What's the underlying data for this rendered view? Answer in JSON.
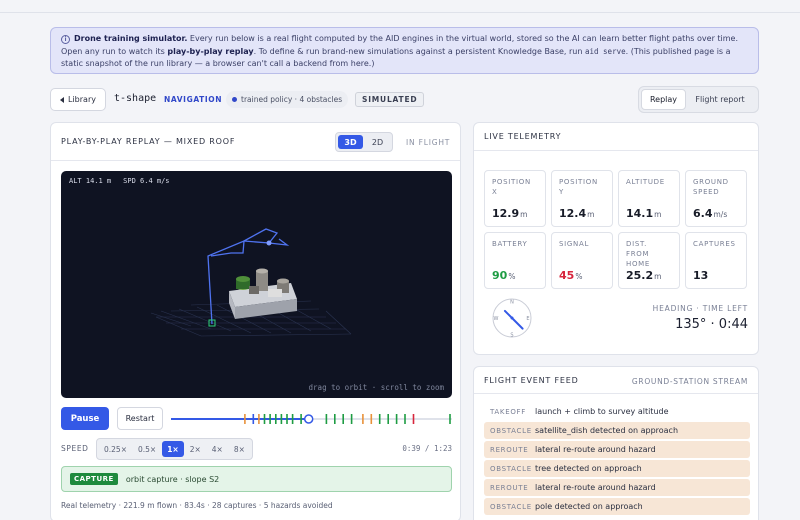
{
  "banner": {
    "title": "Drone training simulator.",
    "text1": " Every run below is a real flight computed by the AID engines in the virtual world, stored so the AI can learn better flight paths over time. Open any run to watch its ",
    "bold2": "play-by-play replay",
    "text2": ". To define & run brand-new simulations against a persistent Knowledge Base, run ",
    "code": "aid serve",
    "text3": ". (This published page is a static snapshot of the run library — a browser can't call a backend from here.)"
  },
  "toolbar": {
    "library_label": "Library",
    "run_name": "t-shape",
    "category": "NAVIGATION",
    "policy": "trained policy · 4 obstacles",
    "badge": "SIMULATED",
    "views": [
      "Replay",
      "Flight report"
    ]
  },
  "replay": {
    "title": "PLAY-BY-PLAY REPLAY — MIXED ROOF",
    "modes": [
      "3D",
      "2D"
    ],
    "status": "IN FLIGHT",
    "hud_alt": "ALT 14.1 m",
    "hud_spd": "SPD 6.4 m/s",
    "hint": "drag to orbit · scroll to zoom",
    "pause_label": "Pause",
    "restart_label": "Restart",
    "progress": 0.49,
    "speed_label": "SPEED",
    "speeds": [
      "0.25×",
      "0.5×",
      "1×",
      "2×",
      "4×",
      "8×"
    ],
    "time_elapsed": "0:39",
    "time_total": "1:23",
    "capture_tag": "CAPTURE",
    "capture_text": "orbit capture · slope S2",
    "footer": "Real telemetry · 221.9 m flown · 83.4s · 28 captures · 5 hazards avoided",
    "timeline_ticks": [
      {
        "p": 0.26,
        "c": "#e8913a"
      },
      {
        "p": 0.29,
        "c": "#3459e6"
      },
      {
        "p": 0.31,
        "c": "#e8913a"
      },
      {
        "p": 0.33,
        "c": "#1e9c43"
      },
      {
        "p": 0.35,
        "c": "#1e9c43"
      },
      {
        "p": 0.37,
        "c": "#1e9c43"
      },
      {
        "p": 0.39,
        "c": "#1e9c43"
      },
      {
        "p": 0.41,
        "c": "#1e9c43"
      },
      {
        "p": 0.43,
        "c": "#1e9c43"
      },
      {
        "p": 0.46,
        "c": "#1e9c43"
      },
      {
        "p": 0.55,
        "c": "#1e9c43"
      },
      {
        "p": 0.58,
        "c": "#1e9c43"
      },
      {
        "p": 0.61,
        "c": "#1e9c43"
      },
      {
        "p": 0.64,
        "c": "#1e9c43"
      },
      {
        "p": 0.68,
        "c": "#e8913a"
      },
      {
        "p": 0.71,
        "c": "#e8913a"
      },
      {
        "p": 0.74,
        "c": "#1e9c43"
      },
      {
        "p": 0.77,
        "c": "#1e9c43"
      },
      {
        "p": 0.8,
        "c": "#1e9c43"
      },
      {
        "p": 0.83,
        "c": "#1e9c43"
      },
      {
        "p": 0.86,
        "c": "#d7263d"
      },
      {
        "p": 0.99,
        "c": "#1e9c43"
      }
    ]
  },
  "telemetry": {
    "title": "LIVE TELEMETRY",
    "tiles": [
      {
        "label": "POSITION X",
        "value": "12.9",
        "unit": "m",
        "tone": ""
      },
      {
        "label": "POSITION Y",
        "value": "12.4",
        "unit": "m",
        "tone": ""
      },
      {
        "label": "ALTITUDE",
        "value": "14.1",
        "unit": "m",
        "tone": ""
      },
      {
        "label": "GROUND SPEED",
        "value": "6.4",
        "unit": "m/s",
        "tone": ""
      },
      {
        "label": "BATTERY",
        "value": "90",
        "unit": "%",
        "tone": "green"
      },
      {
        "label": "SIGNAL",
        "value": "45",
        "unit": "%",
        "tone": "red"
      },
      {
        "label": "DIST. FROM HOME",
        "value": "25.2",
        "unit": "m",
        "tone": ""
      },
      {
        "label": "CAPTURES",
        "value": "13",
        "unit": "",
        "tone": ""
      }
    ],
    "compass": {
      "n": "N",
      "e": "E",
      "s": "S",
      "w": "W"
    },
    "heading_label": "HEADING · TIME LEFT",
    "heading_value": "135° · 0:44",
    "heading_deg": 135
  },
  "feed": {
    "title": "FLIGHT EVENT FEED",
    "subtitle": "GROUND-STATION STREAM",
    "events": [
      {
        "kind": "TAKEOFF",
        "text": "launch + climb to survey altitude",
        "hl": false
      },
      {
        "kind": "OBSTACLE",
        "text": "satellite_dish detected on approach",
        "hl": true
      },
      {
        "kind": "REROUTE",
        "text": "lateral re-route around hazard",
        "hl": true
      },
      {
        "kind": "OBSTACLE",
        "text": "tree detected on approach",
        "hl": true
      },
      {
        "kind": "REROUTE",
        "text": "lateral re-route around hazard",
        "hl": true
      },
      {
        "kind": "OBSTACLE",
        "text": "pole detected on approach",
        "hl": true
      }
    ]
  }
}
